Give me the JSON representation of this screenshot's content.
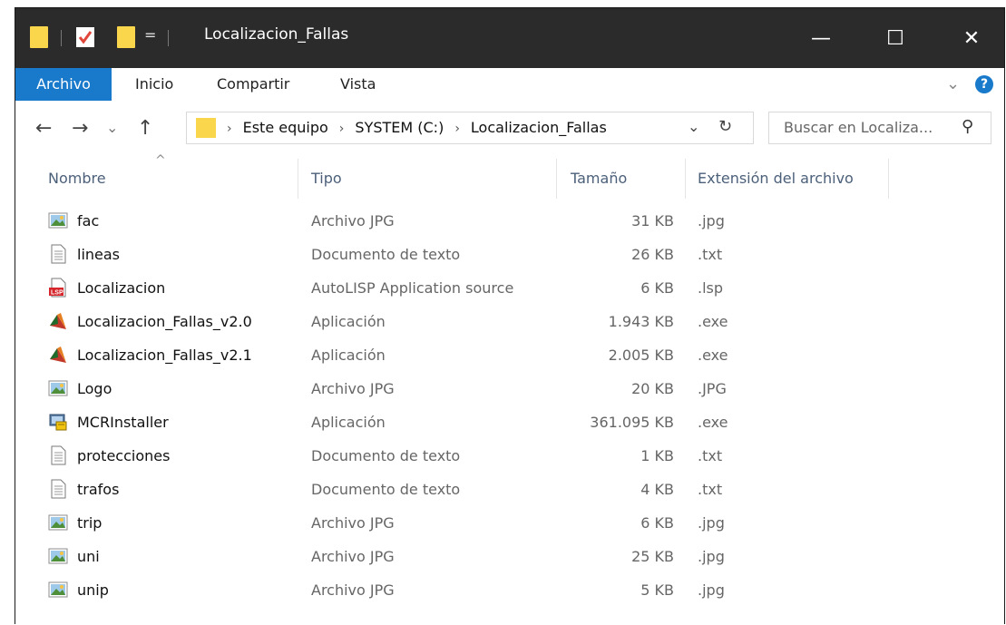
{
  "window": {
    "title": "Localizacion_Fallas",
    "controls": {
      "minimize": "—",
      "maximize": "☐",
      "close": "✕"
    },
    "qat_arrow": "="
  },
  "ribbon": {
    "tabs": [
      "Archivo",
      "Inicio",
      "Compartir",
      "Vista"
    ],
    "chevron": "⌄",
    "help": "?"
  },
  "address": {
    "back": "←",
    "forward": "→",
    "recent": "⌄",
    "up": "↑",
    "crumbs": [
      "Este equipo",
      "SYSTEM (C:)",
      "Localizacion_Fallas"
    ],
    "crumb_sep": "›",
    "dropdown": "⌄",
    "refresh": "↻"
  },
  "search": {
    "placeholder": "Buscar en Localiza...",
    "icon": "⚲"
  },
  "columns": {
    "name": "Nombre",
    "type": "Tipo",
    "size": "Tamaño",
    "ext": "Extensión del archivo",
    "sort_arrow": "^"
  },
  "files": [
    {
      "name": "fac",
      "type": "Archivo JPG",
      "size": "31 KB",
      "ext": ".jpg",
      "icon": "image-file-icon"
    },
    {
      "name": "lineas",
      "type": "Documento de texto",
      "size": "26 KB",
      "ext": ".txt",
      "icon": "text-file-icon"
    },
    {
      "name": "Localizacion",
      "type": "AutoLISP Application source",
      "size": "6 KB",
      "ext": ".lsp",
      "icon": "lisp-file-icon"
    },
    {
      "name": "Localizacion_Fallas_v2.0",
      "type": "Aplicación",
      "size": "1.943 KB",
      "ext": ".exe",
      "icon": "matlab-app-icon"
    },
    {
      "name": "Localizacion_Fallas_v2.1",
      "type": "Aplicación",
      "size": "2.005 KB",
      "ext": ".exe",
      "icon": "matlab-app-icon"
    },
    {
      "name": "Logo",
      "type": "Archivo JPG",
      "size": "20 KB",
      "ext": ".JPG",
      "icon": "image-file-icon"
    },
    {
      "name": "MCRInstaller",
      "type": "Aplicación",
      "size": "361.095 KB",
      "ext": ".exe",
      "icon": "installer-icon"
    },
    {
      "name": "protecciones",
      "type": "Documento de texto",
      "size": "1 KB",
      "ext": ".txt",
      "icon": "text-file-icon"
    },
    {
      "name": "trafos",
      "type": "Documento de texto",
      "size": "4 KB",
      "ext": ".txt",
      "icon": "text-file-icon"
    },
    {
      "name": "trip",
      "type": "Archivo JPG",
      "size": "6 KB",
      "ext": ".jpg",
      "icon": "image-file-icon"
    },
    {
      "name": "uni",
      "type": "Archivo JPG",
      "size": "25 KB",
      "ext": ".jpg",
      "icon": "image-file-icon"
    },
    {
      "name": "unip",
      "type": "Archivo JPG",
      "size": "5 KB",
      "ext": ".jpg",
      "icon": "image-file-icon"
    }
  ],
  "colors": {
    "titlebar": "#2b2b2b",
    "file_tab": "#1979ca",
    "header_text": "#4c607a",
    "folder": "#f9d64b",
    "help": "#1979ca"
  }
}
